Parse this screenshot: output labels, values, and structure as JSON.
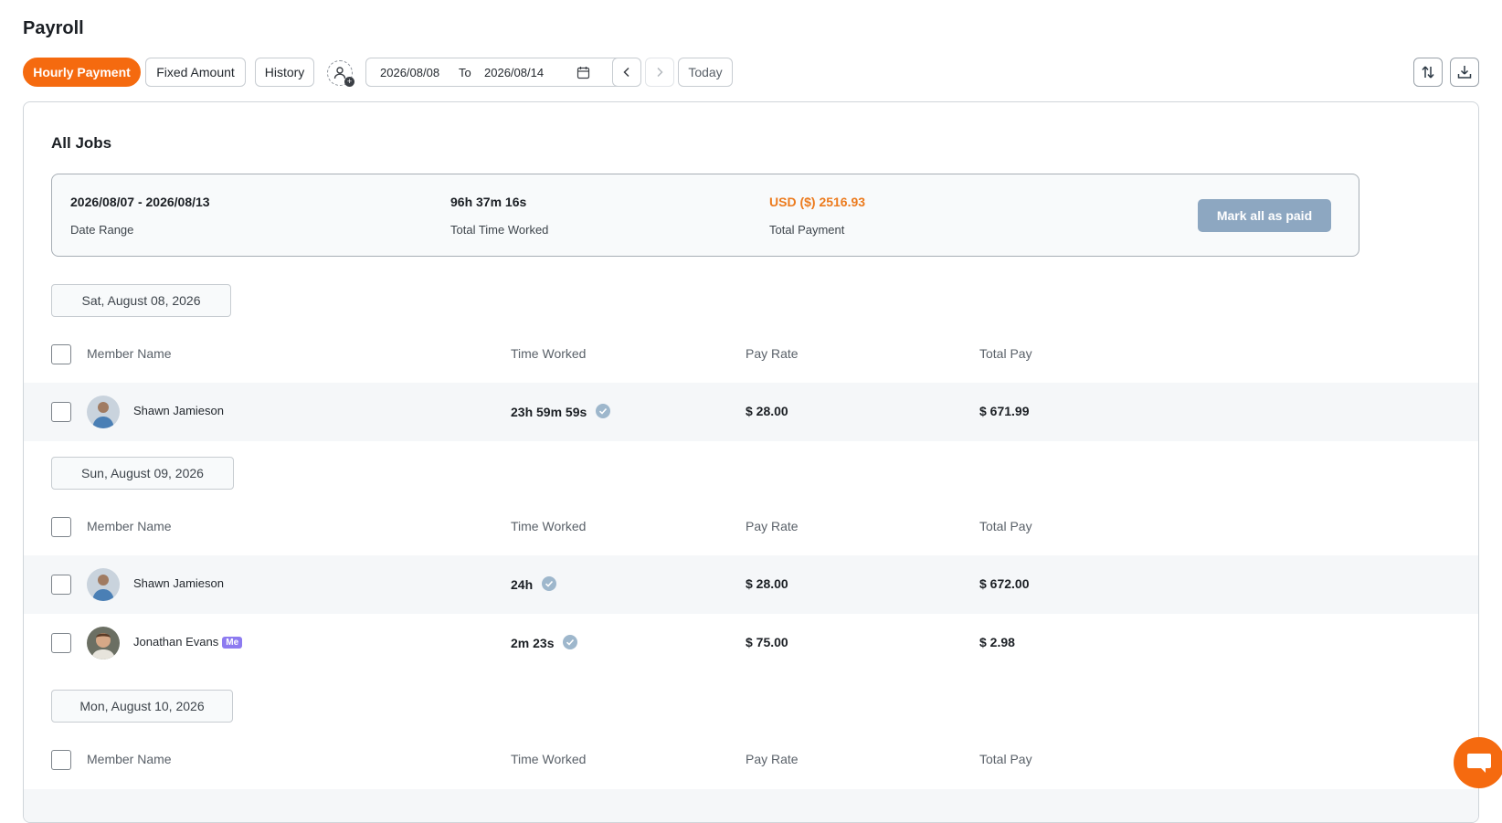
{
  "page": {
    "title": "Payroll"
  },
  "toolbar": {
    "tabs": [
      "Hourly Payment",
      "Fixed Amount",
      "History"
    ],
    "date_from": "2026/08/08",
    "date_sep": "To",
    "date_to": "2026/08/14",
    "today_label": "Today"
  },
  "section": {
    "title": "All Jobs"
  },
  "summary": {
    "date_range_value": "2026/08/07 - 2026/08/13",
    "date_range_label": "Date Range",
    "time_value": "96h 37m 16s",
    "time_label": "Total Time Worked",
    "payment_value": "USD ($) 2516.93",
    "payment_label": "Total Payment",
    "mark_paid_label": "Mark all as paid"
  },
  "columns": [
    "Member Name",
    "Time Worked",
    "Pay Rate",
    "Total Pay"
  ],
  "days": [
    {
      "date": "Sat, August 08, 2026",
      "rows": [
        {
          "name": "Shawn Jamieson",
          "me": false,
          "time": "23h 59m 59s",
          "rate": "$ 28.00",
          "total": "$ 671.99"
        }
      ]
    },
    {
      "date": "Sun, August 09, 2026",
      "rows": [
        {
          "name": "Shawn Jamieson",
          "me": false,
          "time": "24h",
          "rate": "$ 28.00",
          "total": "$ 672.00"
        },
        {
          "name": "Jonathan Evans",
          "me": true,
          "me_label": "Me",
          "time": "2m 23s",
          "rate": "$ 75.00",
          "total": "$ 2.98"
        }
      ]
    },
    {
      "date": "Mon, August 10, 2026",
      "rows": []
    }
  ],
  "colors": {
    "accent": "#f56a0f",
    "payment": "#ec7b1e",
    "mark_button": "#8da7c1",
    "verified": "#9eb7cc"
  }
}
